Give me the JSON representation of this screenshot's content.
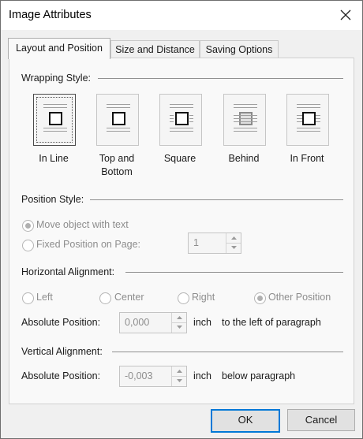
{
  "dialog": {
    "title": "Image Attributes"
  },
  "tabs": [
    {
      "label": "Layout and Position"
    },
    {
      "label": "Size and Distance"
    },
    {
      "label": "Saving Options"
    }
  ],
  "wrapping": {
    "heading": "Wrapping Style:",
    "options": [
      {
        "label_line1": "In Line",
        "label_line2": "",
        "selected": true
      },
      {
        "label_line1": "Top and",
        "label_line2": "Bottom",
        "selected": false
      },
      {
        "label_line1": "Square",
        "label_line2": "",
        "selected": false
      },
      {
        "label_line1": "Behind",
        "label_line2": "",
        "selected": false
      },
      {
        "label_line1": "In Front",
        "label_line2": "",
        "selected": false
      }
    ]
  },
  "position_style": {
    "heading": "Position Style:",
    "move_with_text": "Move object with text",
    "fixed_position": "Fixed Position on Page:",
    "page_value": "1"
  },
  "horizontal": {
    "heading": "Horizontal Alignment:",
    "left": "Left",
    "center": "Center",
    "right": "Right",
    "other": "Other Position",
    "abs_label": "Absolute Position:",
    "abs_value": "0,000",
    "unit": "inch",
    "relative": "to the left of paragraph"
  },
  "vertical": {
    "heading": "Vertical Alignment:",
    "abs_label": "Absolute Position:",
    "abs_value": "-0,003",
    "unit": "inch",
    "relative": "below paragraph"
  },
  "buttons": {
    "ok": "OK",
    "cancel": "Cancel"
  }
}
